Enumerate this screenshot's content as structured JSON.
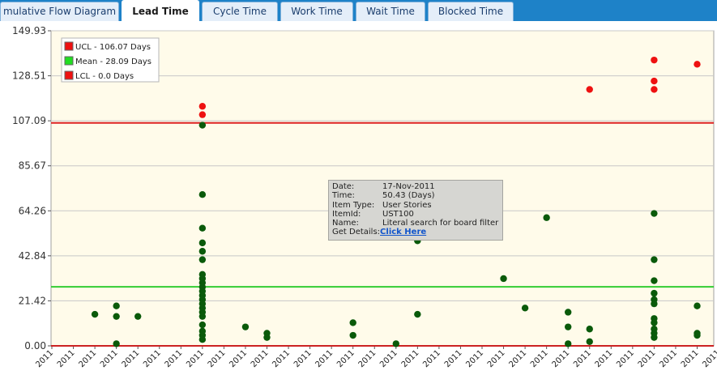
{
  "tabs": [
    {
      "label": "mulative Flow Diagram",
      "active": false
    },
    {
      "label": "Lead Time",
      "active": true
    },
    {
      "label": "Cycle Time",
      "active": false
    },
    {
      "label": "Work Time",
      "active": false
    },
    {
      "label": "Wait Time",
      "active": false
    },
    {
      "label": "Blocked Time",
      "active": false
    }
  ],
  "tooltip": {
    "date_label": "Date:",
    "date_value": "17-Nov-2011",
    "time_label": "Time:",
    "time_value": "50.43 (Days)",
    "item_type_label": "Item Type:",
    "item_type_value": "User Stories",
    "item_id_label": "ItemId:",
    "item_id_value": "UST100",
    "name_label": "Name:",
    "name_value": "Literal search for board filter",
    "details_label": "Get Details:",
    "details_link": "Click Here"
  },
  "chart_data": {
    "type": "scatter",
    "ylim": [
      0,
      149.93
    ],
    "yticks": [
      "0.00",
      "21.42",
      "42.84",
      "64.26",
      "85.67",
      "107.09",
      "128.51",
      "149.93"
    ],
    "xtick_labels": [
      "2011",
      "2011",
      "2011",
      "2011",
      "2011",
      "2011",
      "2011",
      "2011",
      "2011",
      "2011",
      "2011",
      "2011",
      "2011",
      "2011",
      "2011",
      "2011",
      "2011",
      "2011",
      "2011",
      "2011",
      "2011",
      "2011",
      "2011",
      "2011",
      "2011",
      "2011",
      "2011",
      "2011",
      "2011",
      "2011",
      "2011",
      "2011",
      "2011"
    ],
    "grid": true,
    "legend_position": "top-left",
    "legend": [
      {
        "label": "UCL - 106.07 Days",
        "color": "#ee1111"
      },
      {
        "label": "Mean - 28.09 Days",
        "color": "#22dd22"
      },
      {
        "label": "LCL - 0.0 Days",
        "color": "#ee1111"
      }
    ],
    "ucl": 106.07,
    "mean": 28.09,
    "lcl": 0.0,
    "colors": {
      "normal": "#0a5a0a",
      "above_ucl": "#ee1111",
      "ucl_line": "#dd2222",
      "mean_line": "#33cc33",
      "lcl_line": "#cc2222",
      "plot_bg": "#fffbea"
    },
    "points": [
      {
        "x": 2,
        "y": 15
      },
      {
        "x": 3,
        "y": 19
      },
      {
        "x": 3,
        "y": 14
      },
      {
        "x": 3,
        "y": 1
      },
      {
        "x": 4,
        "y": 14
      },
      {
        "x": 7,
        "y": 114
      },
      {
        "x": 7,
        "y": 110
      },
      {
        "x": 7,
        "y": 105
      },
      {
        "x": 7,
        "y": 72
      },
      {
        "x": 7,
        "y": 56
      },
      {
        "x": 7,
        "y": 49
      },
      {
        "x": 7,
        "y": 45
      },
      {
        "x": 7,
        "y": 41
      },
      {
        "x": 7,
        "y": 34
      },
      {
        "x": 7,
        "y": 32
      },
      {
        "x": 7,
        "y": 30
      },
      {
        "x": 7,
        "y": 28
      },
      {
        "x": 7,
        "y": 26
      },
      {
        "x": 7,
        "y": 24
      },
      {
        "x": 7,
        "y": 22
      },
      {
        "x": 7,
        "y": 20
      },
      {
        "x": 7,
        "y": 18
      },
      {
        "x": 7,
        "y": 16
      },
      {
        "x": 7,
        "y": 14
      },
      {
        "x": 7,
        "y": 10
      },
      {
        "x": 7,
        "y": 7
      },
      {
        "x": 7,
        "y": 5
      },
      {
        "x": 7,
        "y": 3
      },
      {
        "x": 9,
        "y": 9
      },
      {
        "x": 10,
        "y": 6
      },
      {
        "x": 10,
        "y": 4
      },
      {
        "x": 14,
        "y": 11
      },
      {
        "x": 14,
        "y": 5
      },
      {
        "x": 16,
        "y": 1
      },
      {
        "x": 17,
        "y": 50
      },
      {
        "x": 17,
        "y": 15
      },
      {
        "x": 21,
        "y": 32
      },
      {
        "x": 22,
        "y": 18
      },
      {
        "x": 23,
        "y": 61
      },
      {
        "x": 24,
        "y": 16
      },
      {
        "x": 24,
        "y": 9
      },
      {
        "x": 24,
        "y": 1
      },
      {
        "x": 25,
        "y": 122
      },
      {
        "x": 25,
        "y": 8
      },
      {
        "x": 25,
        "y": 2
      },
      {
        "x": 28,
        "y": 136
      },
      {
        "x": 28,
        "y": 126
      },
      {
        "x": 28,
        "y": 122
      },
      {
        "x": 28,
        "y": 63
      },
      {
        "x": 28,
        "y": 41
      },
      {
        "x": 28,
        "y": 31
      },
      {
        "x": 28,
        "y": 25
      },
      {
        "x": 28,
        "y": 22
      },
      {
        "x": 28,
        "y": 20
      },
      {
        "x": 28,
        "y": 13
      },
      {
        "x": 28,
        "y": 11
      },
      {
        "x": 28,
        "y": 8
      },
      {
        "x": 28,
        "y": 6
      },
      {
        "x": 28,
        "y": 4
      },
      {
        "x": 30,
        "y": 134
      },
      {
        "x": 30,
        "y": 19
      },
      {
        "x": 30,
        "y": 6
      },
      {
        "x": 30,
        "y": 5
      }
    ]
  }
}
